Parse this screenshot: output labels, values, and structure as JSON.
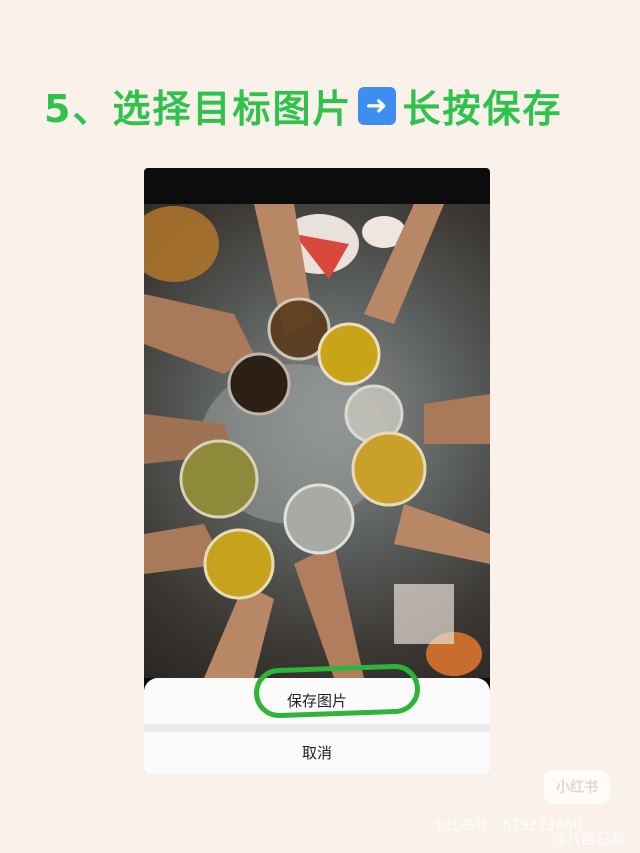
{
  "title": {
    "text": "5、选择目标图片",
    "arrow_icon": "right-arrow-emoji",
    "text_after": "长按保存"
  },
  "action_sheet": {
    "save_label": "保存图片",
    "cancel_label": "取消"
  },
  "watermark": {
    "logo_text": "小红书",
    "account_id": "小红书号：679273660",
    "weibo_handle": "@八酱日常"
  },
  "colors": {
    "title_green": "#2fc24c",
    "highlight_green": "#2fb43a",
    "background": "#faf1ea"
  }
}
